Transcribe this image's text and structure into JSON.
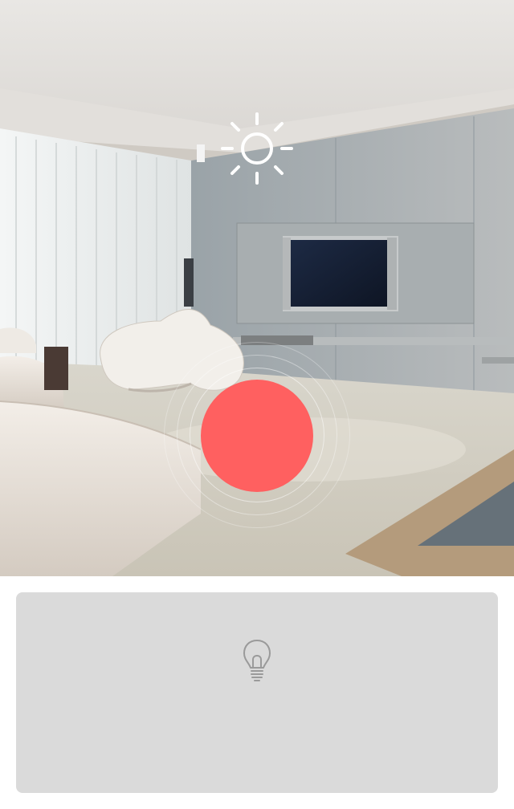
{
  "room": {
    "image_name": "living-room-photo"
  },
  "controls": {
    "brightness_icon": "sun-icon",
    "light_toggle_color": "#ff6060",
    "light_on": true
  },
  "panel": {
    "background": "#dadada",
    "icon": "lightbulb-icon",
    "icon_color": "#9a9a9a"
  }
}
